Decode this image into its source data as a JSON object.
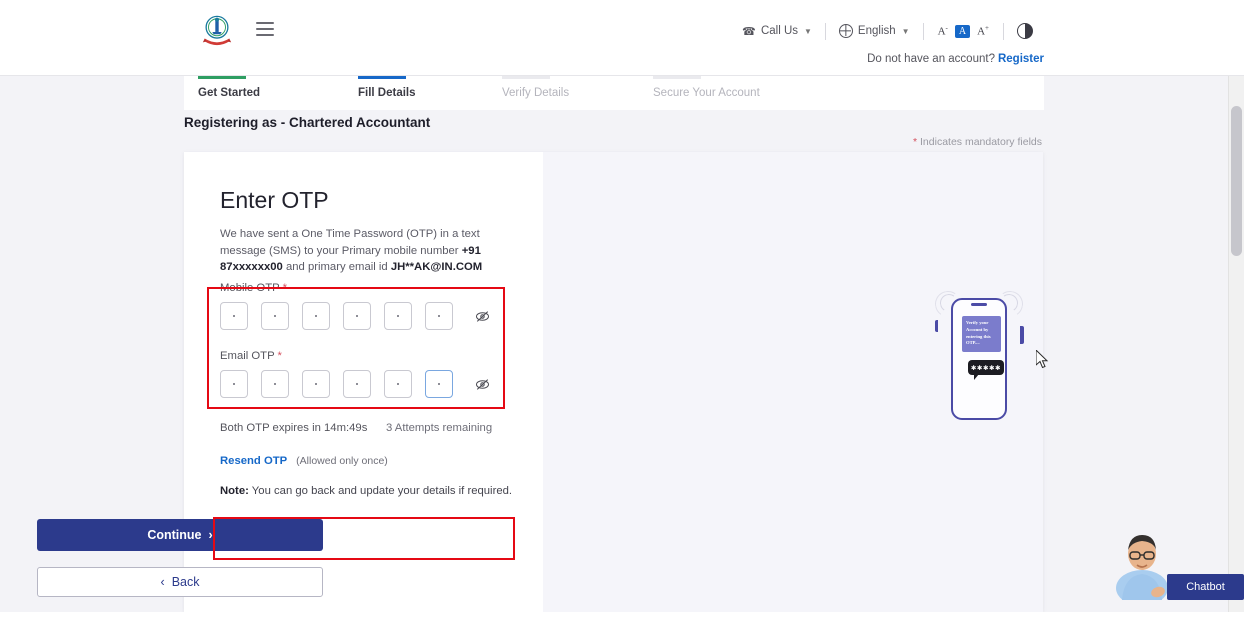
{
  "header": {
    "logo_alt": "Income Tax Department Emblem",
    "menu_icon": "hamburger-menu-icon",
    "call_us": "Call Us",
    "language": "English",
    "font_decrease": "A",
    "font_normal": "A",
    "font_increase": "A",
    "contrast_icon": "contrast-toggle-icon",
    "no_account_text": "Do not have an account?",
    "register_link": "Register"
  },
  "stepper": {
    "steps": [
      {
        "label": "Get Started",
        "state": "done"
      },
      {
        "label": "Fill Details",
        "state": "active"
      },
      {
        "label": "Verify Details",
        "state": "muted"
      },
      {
        "label": "Secure Your Account",
        "state": "muted"
      }
    ]
  },
  "page": {
    "registering_as": "Registering as - Chartered Accountant",
    "mandatory_asterisk": "*",
    "mandatory_note": " Indicates mandatory fields"
  },
  "otp": {
    "title": "Enter OTP",
    "description_part1": "We have sent a One Time Password (OTP) in a text message (SMS) to your Primary mobile number ",
    "mobile_number": "+91 87xxxxxx00",
    "description_part2": " and primary email id ",
    "email_id": "JH**AK@IN.COM",
    "mobile_label": "Mobile OTP ",
    "email_label": "Email OTP ",
    "required_mark": "*",
    "digit_count": 6,
    "mobile_values": [
      "•",
      "•",
      "•",
      "•",
      "•",
      "•"
    ],
    "email_values": [
      "•",
      "•",
      "•",
      "•",
      "•",
      "•"
    ],
    "email_focused_index": 5,
    "toggle_visibility_icon": "eye-off-icon",
    "expiry_text": "Both OTP expires in 14m:49s",
    "attempts_text": "3 Attempts remaining",
    "resend_link": "Resend OTP",
    "resend_note": "(Allowed only once)",
    "note_label": "Note:",
    "note_text": " You can go back and update your details if required.",
    "continue_label": "Continue",
    "continue_chevron": "›",
    "back_chevron": "‹",
    "back_label": "Back"
  },
  "illustration": {
    "bubble_message": "Verify your Account by entering this OTP....",
    "masked_otp": "✱✱✱✱✱",
    "alt": "phone-otp-illustration"
  },
  "chatbot": {
    "label": "Chatbot",
    "avatar_alt": "chatbot-avatar"
  },
  "colors": {
    "primary_blue": "#2c3a8c",
    "link_blue": "#1668c8",
    "step_done_green": "#2e9e62",
    "annotation_red": "#e50914",
    "page_bg": "#f3f3f7"
  }
}
